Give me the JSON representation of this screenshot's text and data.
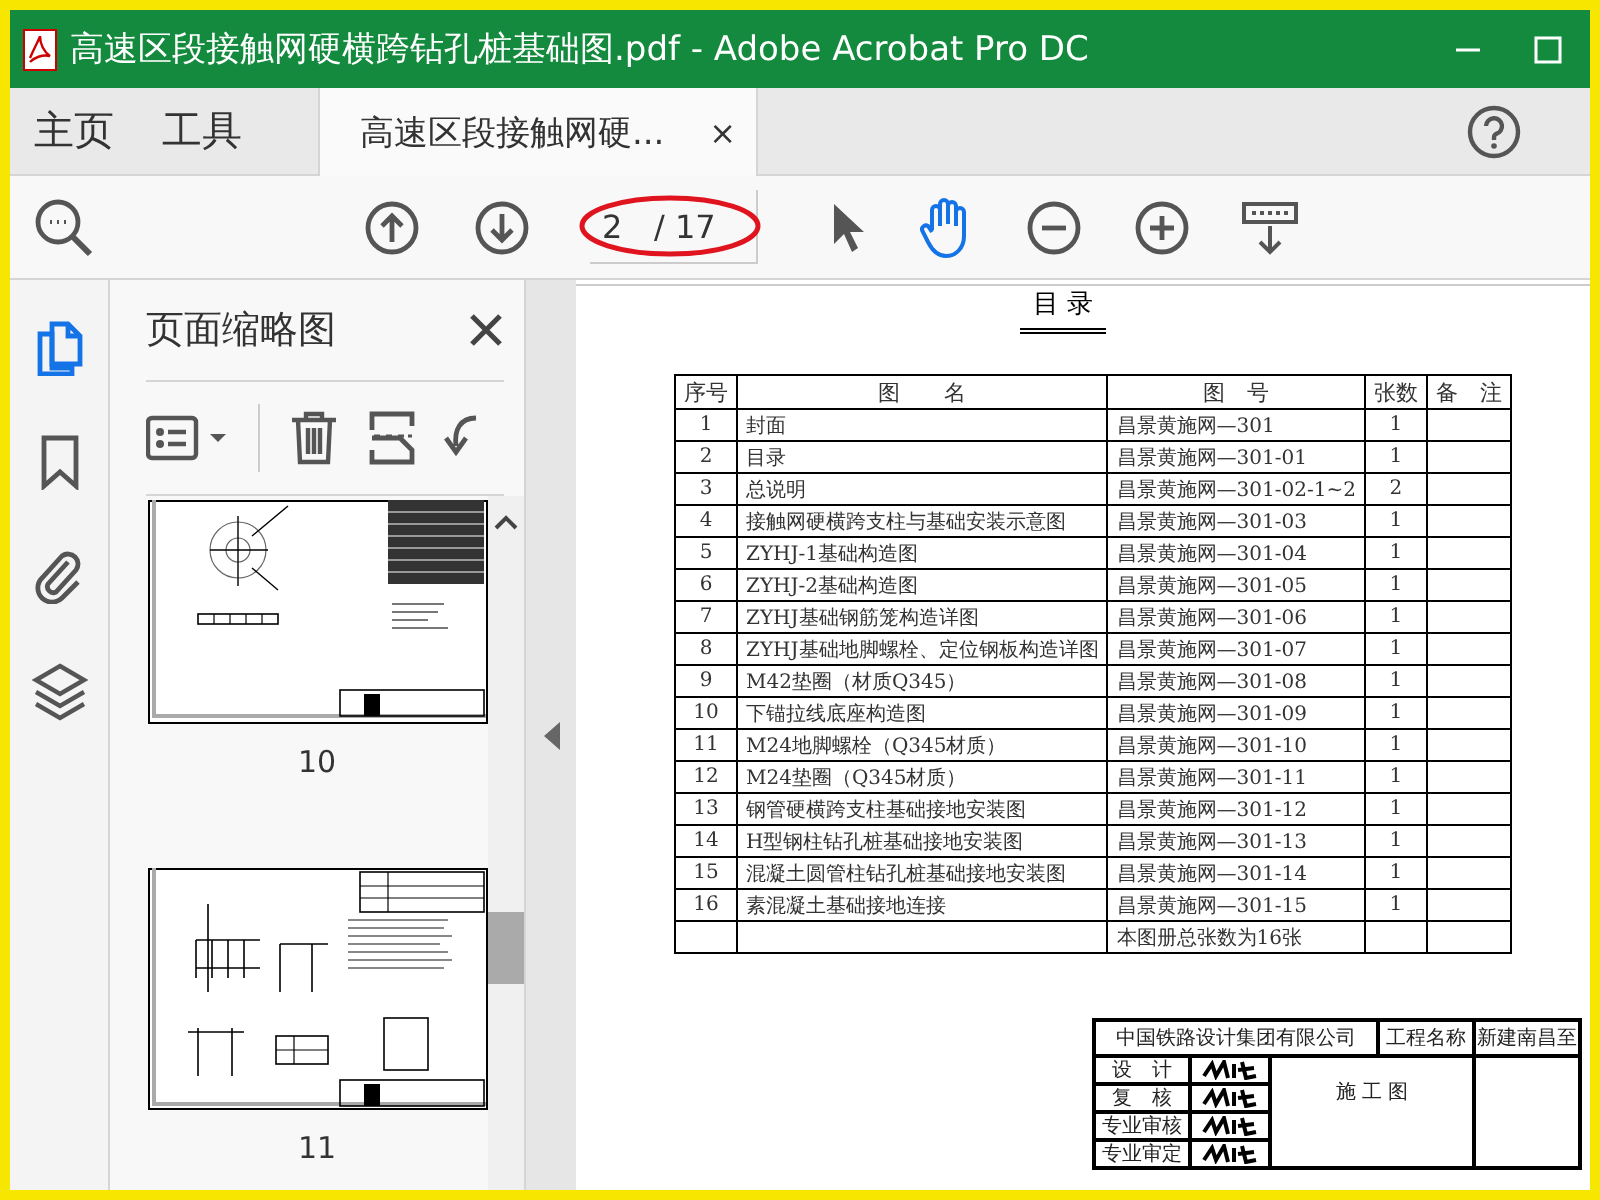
{
  "window": {
    "title": "高速区段接触网硬横跨钻孔桩基础图.pdf - Adobe Acrobat Pro DC"
  },
  "nav_tabs": [
    {
      "label": "主页",
      "selected": false
    },
    {
      "label": "工具",
      "selected": false
    }
  ],
  "document_tab": {
    "label": "高速区段接触网硬...",
    "close": "×",
    "selected": true
  },
  "toolbar": {
    "page": "2",
    "page_total": "/ 17",
    "tools": [
      {
        "kind": "pointer",
        "selected": false
      },
      {
        "kind": "hand",
        "selected": true
      },
      {
        "kind": "zoom-out",
        "selected": false
      },
      {
        "kind": "zoom-in",
        "selected": false
      },
      {
        "kind": "scroll-mode",
        "selected": false
      }
    ]
  },
  "rail": [
    {
      "kind": "pages",
      "selected": true
    },
    {
      "kind": "bookmarks",
      "selected": false
    },
    {
      "kind": "attachments",
      "selected": false
    },
    {
      "kind": "layers",
      "selected": false
    }
  ],
  "thumbnail_panel": {
    "title": "页面缩略图",
    "thumbnails": [
      {
        "label": "10",
        "kind": "washer"
      },
      {
        "label": "11",
        "kind": "details"
      }
    ]
  },
  "document": {
    "heading": "目 录",
    "columns": [
      "序号",
      "图　　名",
      "图　号",
      "张数",
      "备　注"
    ],
    "rows": [
      {
        "no": "1",
        "name": "封面",
        "code": "昌景黄施网—301",
        "sheets": "1"
      },
      {
        "no": "2",
        "name": "目录",
        "code": "昌景黄施网—301-01",
        "sheets": "1"
      },
      {
        "no": "3",
        "name": "总说明",
        "code": "昌景黄施网—301-02-1~2",
        "sheets": "2"
      },
      {
        "no": "4",
        "name": "接触网硬横跨支柱与基础安装示意图",
        "code": "昌景黄施网—301-03",
        "sheets": "1"
      },
      {
        "no": "5",
        "name": "ZYHJ-1基础构造图",
        "code": "昌景黄施网—301-04",
        "sheets": "1"
      },
      {
        "no": "6",
        "name": "ZYHJ-2基础构造图",
        "code": "昌景黄施网—301-05",
        "sheets": "1"
      },
      {
        "no": "7",
        "name": "ZYHJ基础钢筋笼构造详图",
        "code": "昌景黄施网—301-06",
        "sheets": "1"
      },
      {
        "no": "8",
        "name": "ZYHJ基础地脚螺栓、定位钢板构造详图",
        "code": "昌景黄施网—301-07",
        "sheets": "1"
      },
      {
        "no": "9",
        "name": "M42垫圈（材质Q345）",
        "code": "昌景黄施网—301-08",
        "sheets": "1"
      },
      {
        "no": "10",
        "name": "下锚拉线底座构造图",
        "code": "昌景黄施网—301-09",
        "sheets": "1"
      },
      {
        "no": "11",
        "name": "M24地脚螺栓（Q345材质）",
        "code": "昌景黄施网—301-10",
        "sheets": "1"
      },
      {
        "no": "12",
        "name": "M24垫圈（Q345材质）",
        "code": "昌景黄施网—301-11",
        "sheets": "1"
      },
      {
        "no": "13",
        "name": "钢管硬横跨支柱基础接地安装图",
        "code": "昌景黄施网—301-12",
        "sheets": "1"
      },
      {
        "no": "14",
        "name": "H型钢柱钻孔桩基础接地安装图",
        "code": "昌景黄施网—301-13",
        "sheets": "1"
      },
      {
        "no": "15",
        "name": "混凝土圆管柱钻孔桩基础接地安装图",
        "code": "昌景黄施网—301-14",
        "sheets": "1"
      },
      {
        "no": "16",
        "name": "素混凝土基础接地连接",
        "code": "昌景黄施网—301-15",
        "sheets": "1"
      }
    ],
    "total_note": "本图册总张数为16张",
    "title_block": {
      "company": "中国铁路设计集团有限公司",
      "project_label": "工程名称",
      "project": "新建南昌至",
      "stage": "施 工 图",
      "roles": [
        "设　计",
        "复　核",
        "专业审核",
        "专业审定"
      ]
    }
  }
}
